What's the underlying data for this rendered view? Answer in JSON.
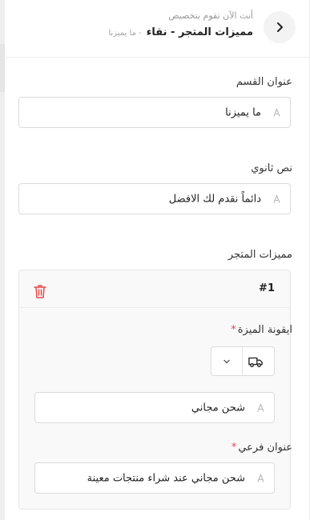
{
  "header": {
    "subtitle": "أنت الآن تقوم بتخصيص",
    "title": "مميزات المتجر - نقاء",
    "breadcrumb": "- ما يميزنا"
  },
  "section_title": {
    "label": "عنوان القسم",
    "value": "ما يميزنا"
  },
  "secondary_text": {
    "label": "نص ثانوي",
    "value": "دائماً نقدم لك الافضل"
  },
  "features": {
    "label": "مميزات المتجر",
    "items": [
      {
        "number": "#1",
        "icon_label": "ايقونة الميزة",
        "icon_required_mark": "*",
        "icon_selected": "truck-icon",
        "icon_text_value": "شحن مجاني",
        "subtitle_label": "عنوان فرعي",
        "subtitle_required_mark": "*",
        "subtitle_value": "شحن مجاني عند شراء منتجات معينة"
      }
    ]
  },
  "colors": {
    "accent_red": "#e24a4a",
    "border": "#dcdcdc",
    "panel_bg": "#f9f9f9"
  }
}
